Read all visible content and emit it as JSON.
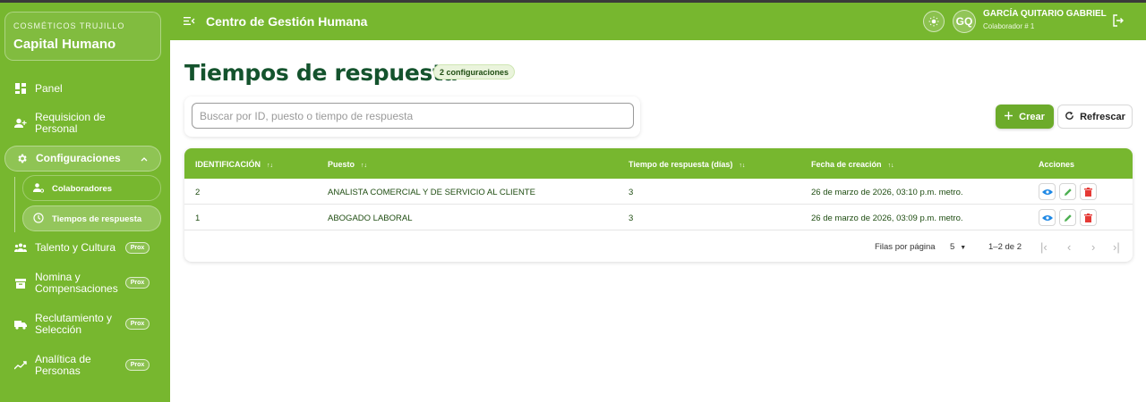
{
  "brand": {
    "company": "COSMÉTICOS TRUJILLO",
    "app_name": "Capital Humano"
  },
  "sidebar": {
    "items": [
      {
        "label": "Panel",
        "icon": "dashboard-icon"
      },
      {
        "label": "Requisicion de Personal",
        "icon": "person-add-icon"
      },
      {
        "label": "Configuraciones",
        "icon": "gear-icon",
        "expanded": true
      },
      {
        "label": "Talento y Cultura",
        "icon": "people-icon",
        "badge": "Prox"
      },
      {
        "label": "Nomina y Compensaciones",
        "icon": "archive-icon",
        "badge": "Prox"
      },
      {
        "label": "Reclutamiento y Selección",
        "icon": "truck-icon",
        "badge": "Prox"
      },
      {
        "label": "Analítica de Personas",
        "icon": "trend-icon",
        "badge": "Prox"
      }
    ],
    "subitems": [
      {
        "label": "Colaboradores",
        "icon": "person-gear-icon"
      },
      {
        "label": "Tiempos de respuesta",
        "icon": "clock-icon",
        "active": true
      }
    ]
  },
  "header": {
    "title": "Centro de Gestión Humana",
    "user_initials": "GQ",
    "user_name": "GARCÍA QUITARIO GABRIEL",
    "user_role": "Colaborador # 1"
  },
  "main": {
    "title": "Tiempos de respuesta",
    "badge": "2 configuraciones",
    "search_placeholder": "Buscar por ID, puesto o tiempo de respuesta",
    "create_label": "Crear",
    "refresh_label": "Refrescar"
  },
  "table": {
    "columns": [
      "IDENTIFICACIÓN",
      "Puesto",
      "Tiempo de respuesta (días)",
      "Fecha de creación",
      "Acciones"
    ],
    "rows": [
      {
        "id": "2",
        "puesto": "ANALISTA COMERCIAL Y DE SERVICIO AL CLIENTE",
        "tiempo": "3",
        "fecha": "26 de marzo de 2026, 03:10 p.m. metro."
      },
      {
        "id": "1",
        "puesto": "ABOGADO LABORAL",
        "tiempo": "3",
        "fecha": "26 de marzo de 2026, 03:09 p.m. metro."
      }
    ],
    "rows_per_page_label": "Filas por página",
    "rows_per_page": "5",
    "range": "1–2 de 2"
  },
  "colors": {
    "primary": "#77b72f",
    "title": "#14532d",
    "view": "#1e88e5",
    "edit": "#4caf50",
    "delete": "#e53935"
  }
}
